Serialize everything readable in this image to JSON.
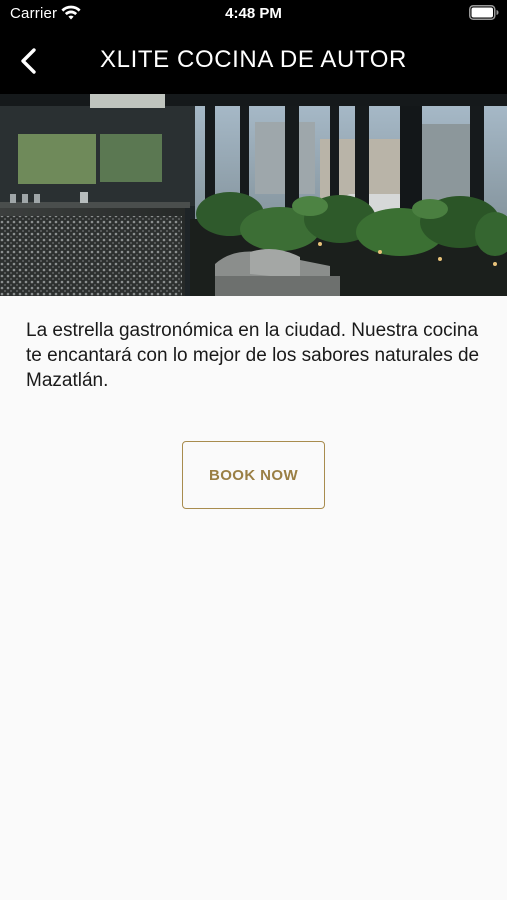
{
  "status_bar": {
    "carrier": "Carrier",
    "time": "4:48 PM",
    "wifi_icon": "wifi-icon",
    "battery_icon": "battery-icon"
  },
  "nav": {
    "back_icon": "chevron-left-icon",
    "title": "XLITE COCINA DE AUTOR"
  },
  "hero": {
    "image_subject": "restaurant interior with bar, plants, sofa and large windows"
  },
  "content": {
    "description": "La estrella gastronómica en la ciudad. Nuestra cocina te encantará con lo mejor de los sabores naturales de Mazatlán."
  },
  "actions": {
    "book_label": "BOOK NOW"
  },
  "colors": {
    "header_bg": "#000000",
    "page_bg": "#fafafa",
    "accent_gold": "#a88c4e",
    "text": "#1a1a1a"
  }
}
